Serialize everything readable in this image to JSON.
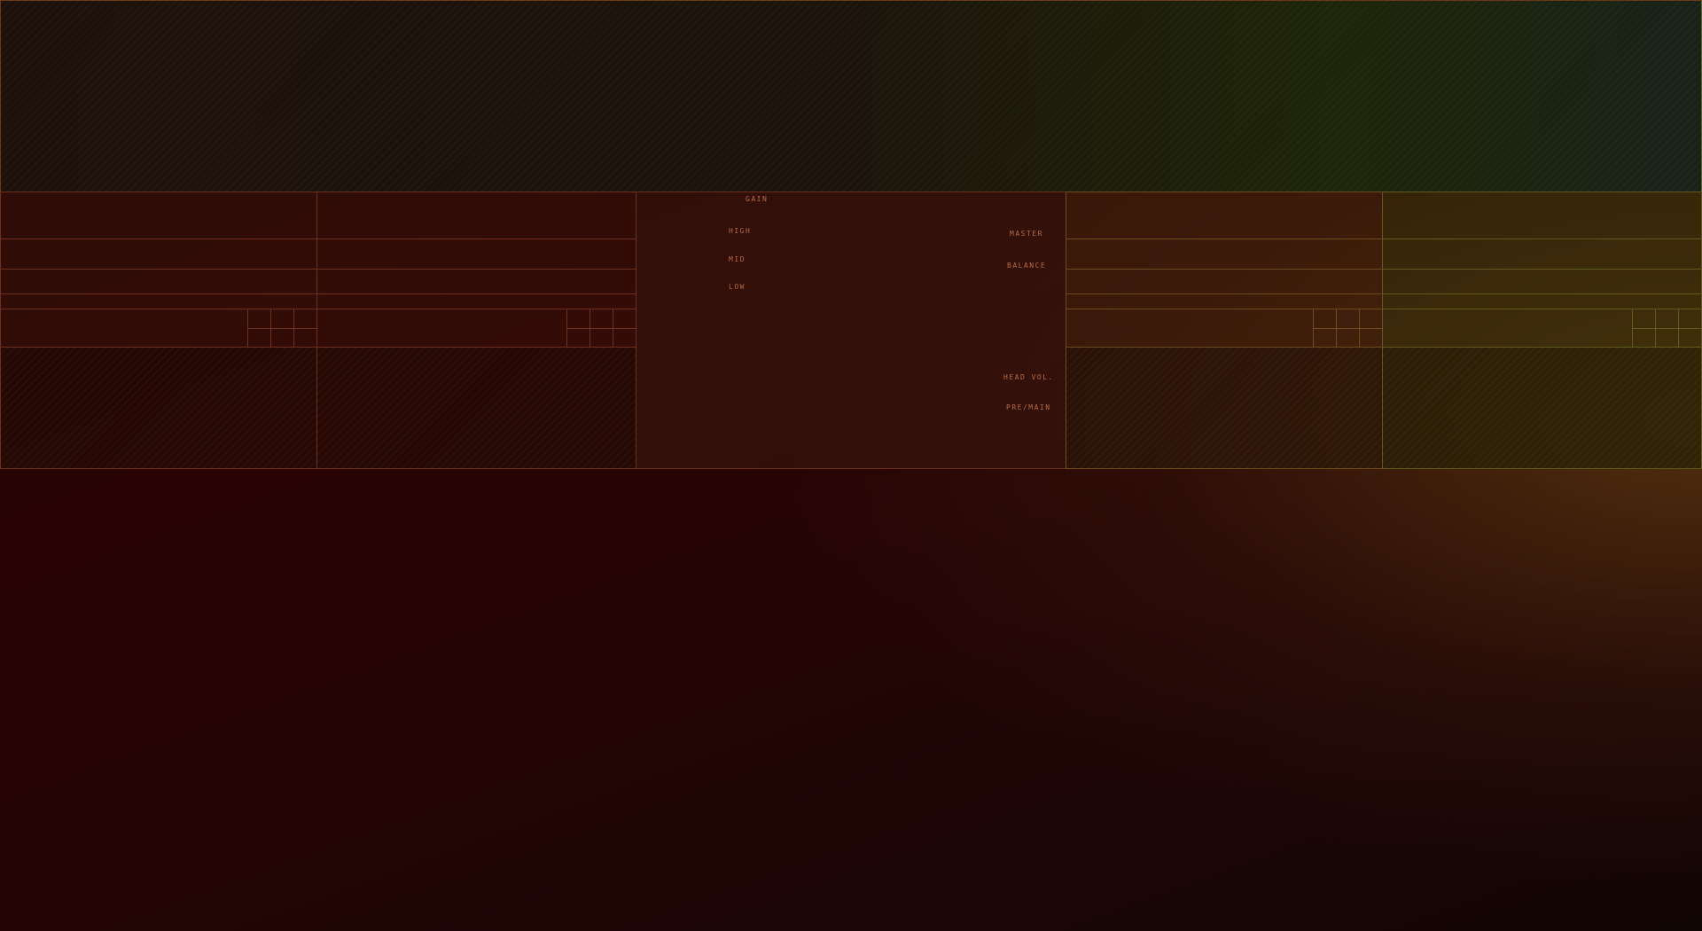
{
  "mixer": {
    "gain_label": "GAIN",
    "high_label": "HIGH",
    "mid_label": "MID",
    "low_label": "LOW",
    "master_label": "MASTER",
    "balance_label": "BALANCE",
    "head_vol_label": "HEAD VOL.",
    "pre_main_label": "PRE/MAIN"
  },
  "colors": {
    "accent": "#b86a45",
    "deck_line_left": "#6e2f1b",
    "deck_line_right": "#5f5a1e",
    "background": "#2a0404"
  }
}
